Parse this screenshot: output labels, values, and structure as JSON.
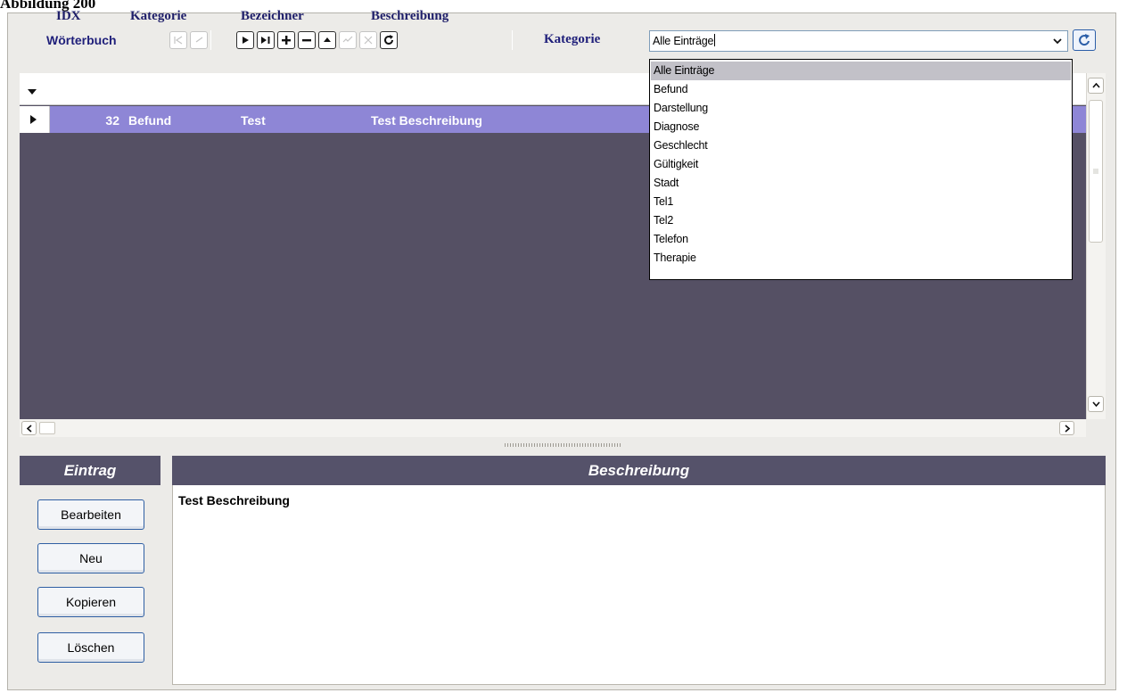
{
  "document": {
    "caption": "Abbildung 200"
  },
  "toolbar": {
    "title": "Wörterbuch",
    "category_label": "Kategorie",
    "nav_buttons": [
      "first",
      "prior",
      "next",
      "last",
      "insert",
      "delete",
      "edit",
      "post",
      "cancel",
      "refresh"
    ]
  },
  "category_combo": {
    "value": "Alle Einträge",
    "options": [
      "Alle Einträge",
      "Befund",
      "Darstellung",
      "Diagnose",
      "Geschlecht",
      "Gültigkeit",
      "Stadt",
      "Tel1",
      "Tel2",
      "Telefon",
      "Therapie"
    ],
    "highlighted": "Alle Einträge"
  },
  "grid": {
    "columns": [
      "IDX",
      "Kategorie",
      "Bezeichner",
      "Beschreibung"
    ],
    "rows": [
      {
        "idx": "32",
        "kategorie": "Befund",
        "bezeichner": "Test",
        "beschreibung": "Test Beschreibung"
      }
    ]
  },
  "entry_panel": {
    "title": "Eintrag",
    "buttons": [
      "Bearbeiten",
      "Neu",
      "Kopieren",
      "Löschen"
    ]
  },
  "description_panel": {
    "title": "Beschreibung",
    "text": "Test Beschreibung"
  },
  "colors": {
    "grid_background": "#555064",
    "selected_row": "#8e86d6",
    "panel_header": "#55526a",
    "label_text": "#1f1f7a"
  }
}
